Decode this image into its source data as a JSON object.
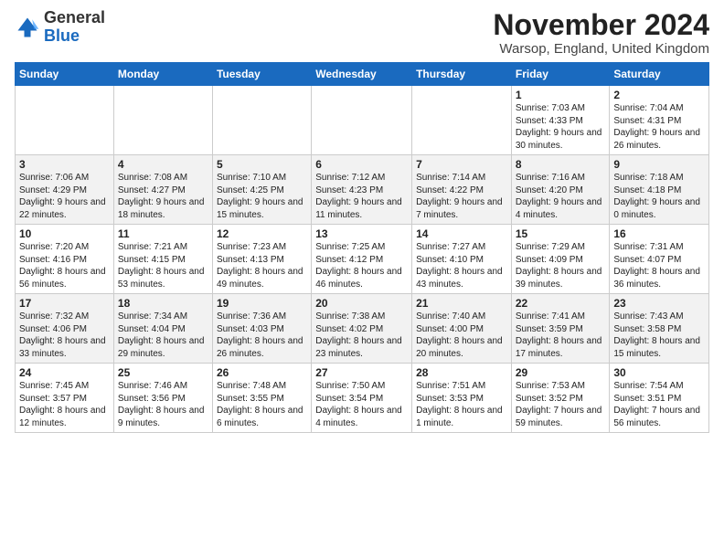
{
  "header": {
    "logo_general": "General",
    "logo_blue": "Blue",
    "title": "November 2024",
    "subtitle": "Warsop, England, United Kingdom"
  },
  "columns": [
    "Sunday",
    "Monday",
    "Tuesday",
    "Wednesday",
    "Thursday",
    "Friday",
    "Saturday"
  ],
  "weeks": [
    [
      {
        "day": "",
        "info": ""
      },
      {
        "day": "",
        "info": ""
      },
      {
        "day": "",
        "info": ""
      },
      {
        "day": "",
        "info": ""
      },
      {
        "day": "",
        "info": ""
      },
      {
        "day": "1",
        "info": "Sunrise: 7:03 AM\nSunset: 4:33 PM\nDaylight: 9 hours and 30 minutes."
      },
      {
        "day": "2",
        "info": "Sunrise: 7:04 AM\nSunset: 4:31 PM\nDaylight: 9 hours and 26 minutes."
      }
    ],
    [
      {
        "day": "3",
        "info": "Sunrise: 7:06 AM\nSunset: 4:29 PM\nDaylight: 9 hours and 22 minutes."
      },
      {
        "day": "4",
        "info": "Sunrise: 7:08 AM\nSunset: 4:27 PM\nDaylight: 9 hours and 18 minutes."
      },
      {
        "day": "5",
        "info": "Sunrise: 7:10 AM\nSunset: 4:25 PM\nDaylight: 9 hours and 15 minutes."
      },
      {
        "day": "6",
        "info": "Sunrise: 7:12 AM\nSunset: 4:23 PM\nDaylight: 9 hours and 11 minutes."
      },
      {
        "day": "7",
        "info": "Sunrise: 7:14 AM\nSunset: 4:22 PM\nDaylight: 9 hours and 7 minutes."
      },
      {
        "day": "8",
        "info": "Sunrise: 7:16 AM\nSunset: 4:20 PM\nDaylight: 9 hours and 4 minutes."
      },
      {
        "day": "9",
        "info": "Sunrise: 7:18 AM\nSunset: 4:18 PM\nDaylight: 9 hours and 0 minutes."
      }
    ],
    [
      {
        "day": "10",
        "info": "Sunrise: 7:20 AM\nSunset: 4:16 PM\nDaylight: 8 hours and 56 minutes."
      },
      {
        "day": "11",
        "info": "Sunrise: 7:21 AM\nSunset: 4:15 PM\nDaylight: 8 hours and 53 minutes."
      },
      {
        "day": "12",
        "info": "Sunrise: 7:23 AM\nSunset: 4:13 PM\nDaylight: 8 hours and 49 minutes."
      },
      {
        "day": "13",
        "info": "Sunrise: 7:25 AM\nSunset: 4:12 PM\nDaylight: 8 hours and 46 minutes."
      },
      {
        "day": "14",
        "info": "Sunrise: 7:27 AM\nSunset: 4:10 PM\nDaylight: 8 hours and 43 minutes."
      },
      {
        "day": "15",
        "info": "Sunrise: 7:29 AM\nSunset: 4:09 PM\nDaylight: 8 hours and 39 minutes."
      },
      {
        "day": "16",
        "info": "Sunrise: 7:31 AM\nSunset: 4:07 PM\nDaylight: 8 hours and 36 minutes."
      }
    ],
    [
      {
        "day": "17",
        "info": "Sunrise: 7:32 AM\nSunset: 4:06 PM\nDaylight: 8 hours and 33 minutes."
      },
      {
        "day": "18",
        "info": "Sunrise: 7:34 AM\nSunset: 4:04 PM\nDaylight: 8 hours and 29 minutes."
      },
      {
        "day": "19",
        "info": "Sunrise: 7:36 AM\nSunset: 4:03 PM\nDaylight: 8 hours and 26 minutes."
      },
      {
        "day": "20",
        "info": "Sunrise: 7:38 AM\nSunset: 4:02 PM\nDaylight: 8 hours and 23 minutes."
      },
      {
        "day": "21",
        "info": "Sunrise: 7:40 AM\nSunset: 4:00 PM\nDaylight: 8 hours and 20 minutes."
      },
      {
        "day": "22",
        "info": "Sunrise: 7:41 AM\nSunset: 3:59 PM\nDaylight: 8 hours and 17 minutes."
      },
      {
        "day": "23",
        "info": "Sunrise: 7:43 AM\nSunset: 3:58 PM\nDaylight: 8 hours and 15 minutes."
      }
    ],
    [
      {
        "day": "24",
        "info": "Sunrise: 7:45 AM\nSunset: 3:57 PM\nDaylight: 8 hours and 12 minutes."
      },
      {
        "day": "25",
        "info": "Sunrise: 7:46 AM\nSunset: 3:56 PM\nDaylight: 8 hours and 9 minutes."
      },
      {
        "day": "26",
        "info": "Sunrise: 7:48 AM\nSunset: 3:55 PM\nDaylight: 8 hours and 6 minutes."
      },
      {
        "day": "27",
        "info": "Sunrise: 7:50 AM\nSunset: 3:54 PM\nDaylight: 8 hours and 4 minutes."
      },
      {
        "day": "28",
        "info": "Sunrise: 7:51 AM\nSunset: 3:53 PM\nDaylight: 8 hours and 1 minute."
      },
      {
        "day": "29",
        "info": "Sunrise: 7:53 AM\nSunset: 3:52 PM\nDaylight: 7 hours and 59 minutes."
      },
      {
        "day": "30",
        "info": "Sunrise: 7:54 AM\nSunset: 3:51 PM\nDaylight: 7 hours and 56 minutes."
      }
    ]
  ]
}
